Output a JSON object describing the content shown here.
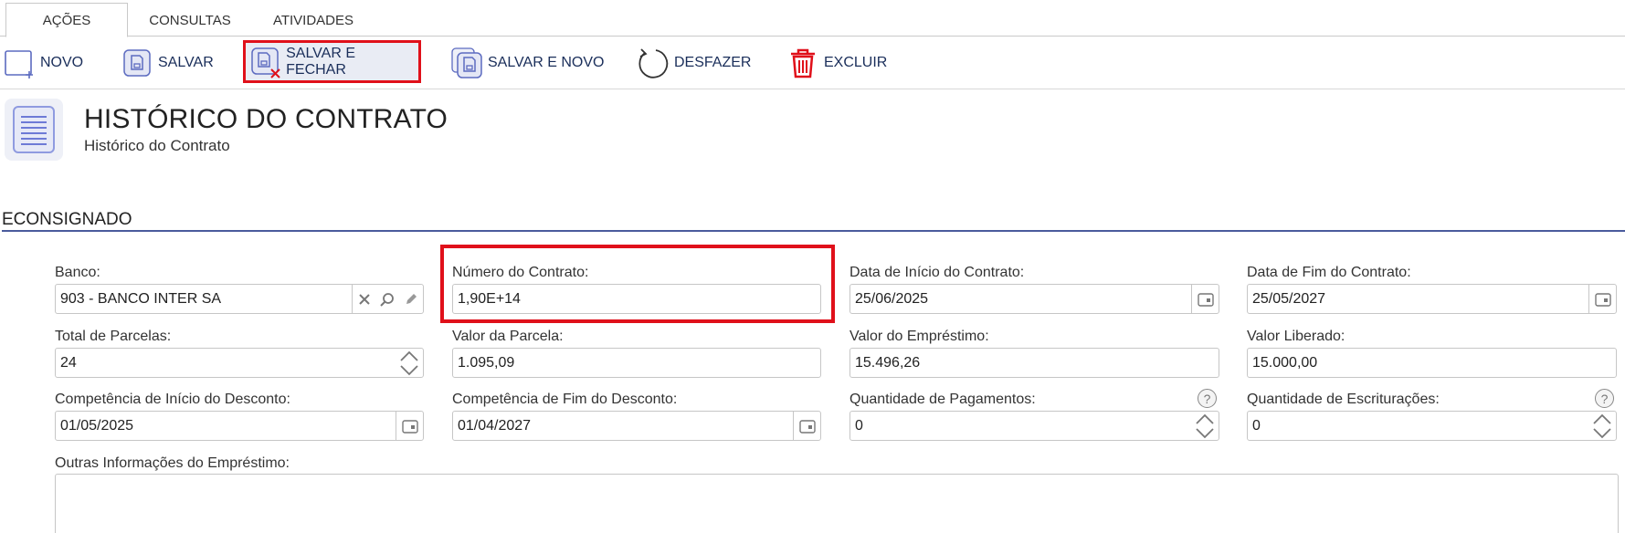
{
  "tabs": [
    {
      "label": "AÇÕES",
      "active": true
    },
    {
      "label": "CONSULTAS",
      "active": false
    },
    {
      "label": "ATIVIDADES",
      "active": false
    }
  ],
  "toolbar": {
    "novo": "NOVO",
    "salvar": "SALVAR",
    "salvar_fechar": "SALVAR E FECHAR",
    "salvar_novo": "SALVAR E NOVO",
    "desfazer": "DESFAZER",
    "excluir": "EXCLUIR"
  },
  "header": {
    "title": "HISTÓRICO DO CONTRATO",
    "subtitle": "Histórico do Contrato"
  },
  "section": {
    "title": "ECONSIGNADO"
  },
  "fields": {
    "banco": {
      "label": "Banco:",
      "value": "903 - BANCO INTER SA"
    },
    "numero_contrato": {
      "label": "Número do Contrato:",
      "value": "1,90E+14"
    },
    "data_inicio": {
      "label": "Data de Início do Contrato:",
      "value": "25/06/2025"
    },
    "data_fim": {
      "label": "Data de Fim do Contrato:",
      "value": "25/05/2027"
    },
    "total_parcelas": {
      "label": "Total de Parcelas:",
      "value": "24"
    },
    "valor_parcela": {
      "label": "Valor da Parcela:",
      "value": "1.095,09"
    },
    "valor_emprestimo": {
      "label": "Valor do Empréstimo:",
      "value": "15.496,26"
    },
    "valor_liberado": {
      "label": "Valor Liberado:",
      "value": "15.000,00"
    },
    "comp_inicio": {
      "label": "Competência de Início do Desconto:",
      "value": "01/05/2025"
    },
    "comp_fim": {
      "label": "Competência de Fim do Desconto:",
      "value": "01/04/2027"
    },
    "qtd_pagamentos": {
      "label": "Quantidade de Pagamentos:",
      "value": "0"
    },
    "qtd_escrituracoes": {
      "label": "Quantidade de Escriturações:",
      "value": "0"
    },
    "outras_info": {
      "label": "Outras Informações do Empréstimo:",
      "value": ""
    }
  },
  "help_glyph": "?",
  "colors": {
    "highlight": "#e0101a",
    "navy_text": "#1a2e5a",
    "icon_blue": "#5c6bc0",
    "delete_red": "#e0101a",
    "section_line": "#4a5b9c"
  }
}
